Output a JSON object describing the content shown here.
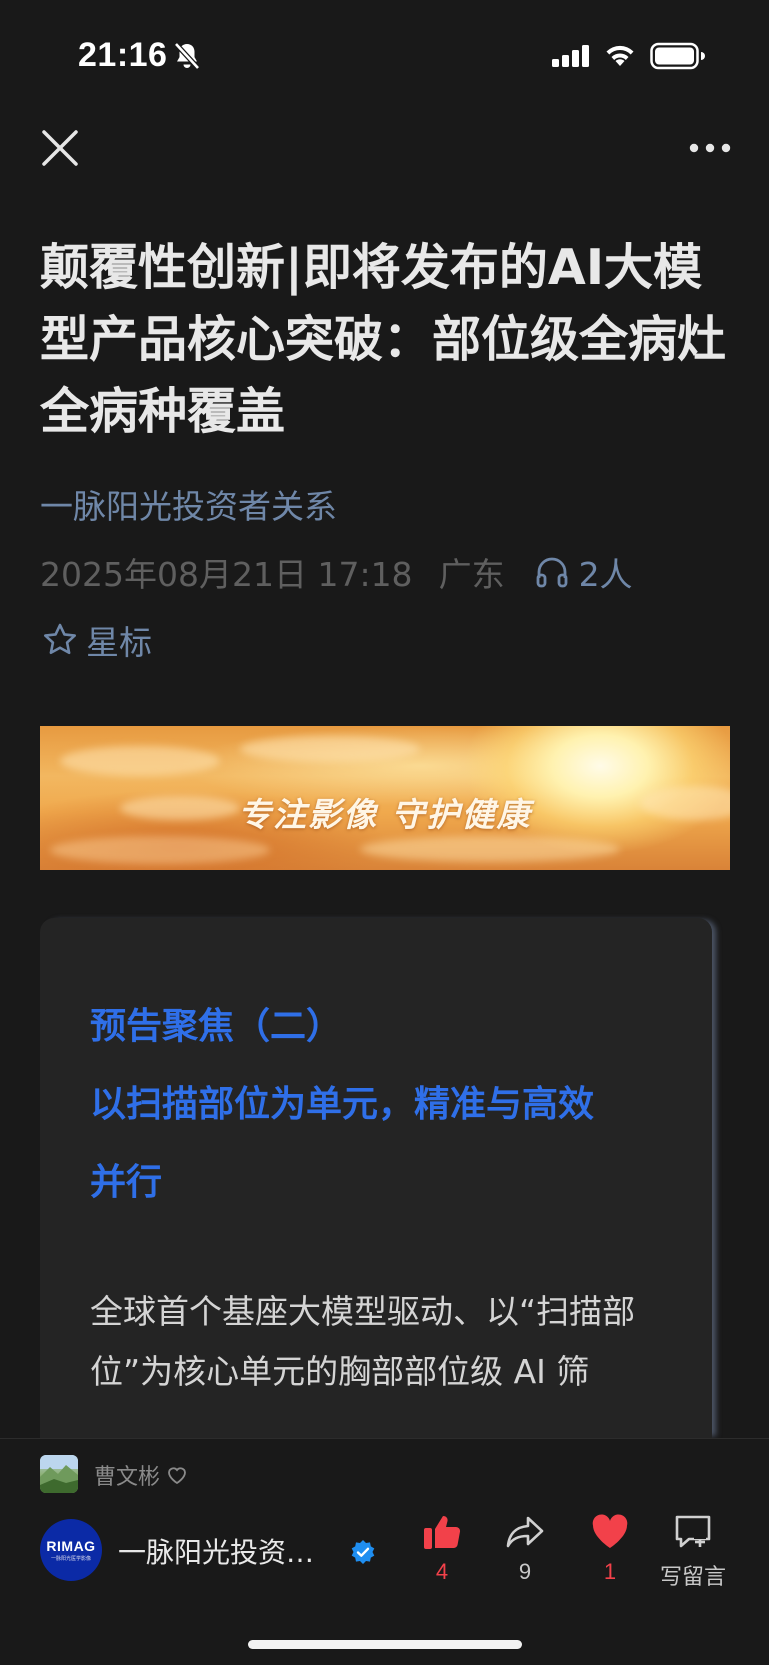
{
  "status_bar": {
    "time": "21:16"
  },
  "nav": {
    "close_icon": "close-icon",
    "more_icon": "more-icon"
  },
  "article": {
    "title": "颠覆性创新|即将发布的AI大模型产品核心突破：部位级全病灶全病种覆盖",
    "account_name": "一脉阳光投资者关系",
    "date": "2025年08月21日 17:18",
    "region": "广东",
    "listeners": "2人",
    "star_label": "星标"
  },
  "banner": {
    "slogan": "专注影像  守护健康"
  },
  "card": {
    "heading_lines": [
      "预告聚焦（二）",
      "以扫描部位为单元，精准与高效",
      "并行"
    ],
    "body": "全球首个基座大模型驱动、以“扫描部位”为核心单元的胸部部位级 AI 筛"
  },
  "bottom_bar": {
    "sharer_name": "曹文彬",
    "account_logo_text": "RIMAG",
    "account_logo_sub": "一脉阳光医学影像",
    "account_name": "一脉阳光投资…",
    "like_count": "4",
    "share_count": "9",
    "heart_count": "1",
    "comment_label": "写留言"
  },
  "colors": {
    "background": "#191919",
    "accent_blue": "#2f6fe8",
    "link_gray_blue": "#6f87a8",
    "red": "#f2414a"
  }
}
